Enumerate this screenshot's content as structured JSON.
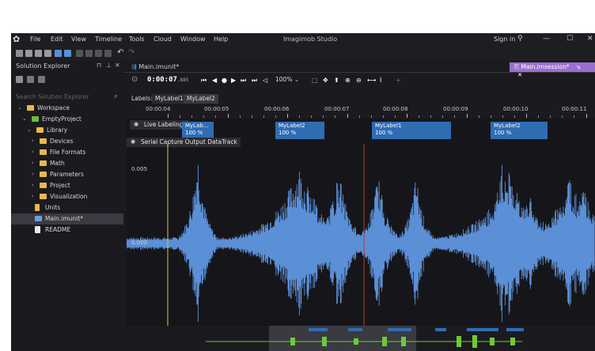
{
  "menubar": {
    "items": [
      "File",
      "Edit",
      "View",
      "Timeline",
      "Tools",
      "Cloud",
      "Window",
      "Help"
    ],
    "app_title": "Imagimob Studio",
    "sign_in": "Sign in"
  },
  "solution_explorer": {
    "title": "Solution Explorer",
    "search_placeholder": "Search Solution Explorer",
    "tree": [
      {
        "label": "Workspace",
        "level": 0,
        "type": "workspace"
      },
      {
        "label": "EmptyProject",
        "level": 1,
        "type": "project"
      },
      {
        "label": "Library",
        "level": 2,
        "type": "folder"
      },
      {
        "label": "Devices",
        "level": 3,
        "type": "folder"
      },
      {
        "label": "File Formats",
        "level": 3,
        "type": "folder"
      },
      {
        "label": "Math",
        "level": 3,
        "type": "folder"
      },
      {
        "label": "Parameters",
        "level": 3,
        "type": "folder"
      },
      {
        "label": "Project",
        "level": 3,
        "type": "folder"
      },
      {
        "label": "Visualization",
        "level": 3,
        "type": "folder"
      },
      {
        "label": "Units",
        "level": 2,
        "type": "folder"
      },
      {
        "label": "Main.imunit*",
        "level": 2,
        "type": "file",
        "selected": true
      },
      {
        "label": "README",
        "level": 2,
        "type": "doc"
      }
    ]
  },
  "doc_tabs": {
    "left": "Main.imunit*",
    "right": "Main.imsession*"
  },
  "transport": {
    "time": "0:00:07",
    "time_ms": ".885",
    "zoom": "100%"
  },
  "label_tabs": [
    "Labels:",
    "MyLabel1",
    "MyLabel2"
  ],
  "ruler": {
    "ticks": [
      "00:00:04",
      "00:00:05",
      "00:00:06",
      "00:00:07",
      "00:00:08",
      "00:00:09",
      "00:00:10",
      "00:00:11"
    ]
  },
  "tracks": {
    "live_labeling": "Live Labeling*",
    "data_track": "Serial Capture Output DataTrack",
    "y_top": "0.005",
    "y_mid": "0.000"
  },
  "labels": [
    {
      "name": "MyLab...",
      "pct": "100 %"
    },
    {
      "name": "MyLabel2",
      "pct": "100 %"
    },
    {
      "name": "MyLabel1",
      "pct": "100 %"
    },
    {
      "name": "MyLabel2",
      "pct": "100 %"
    }
  ],
  "colors": {
    "waveform": "#5b8fd6",
    "label_box": "#2f6db3",
    "session_tab": "#9b6fd1",
    "cursor_red": "#c0392b",
    "cursor_yellow": "#d9c84a",
    "overview_wave": "#6dc93a"
  }
}
